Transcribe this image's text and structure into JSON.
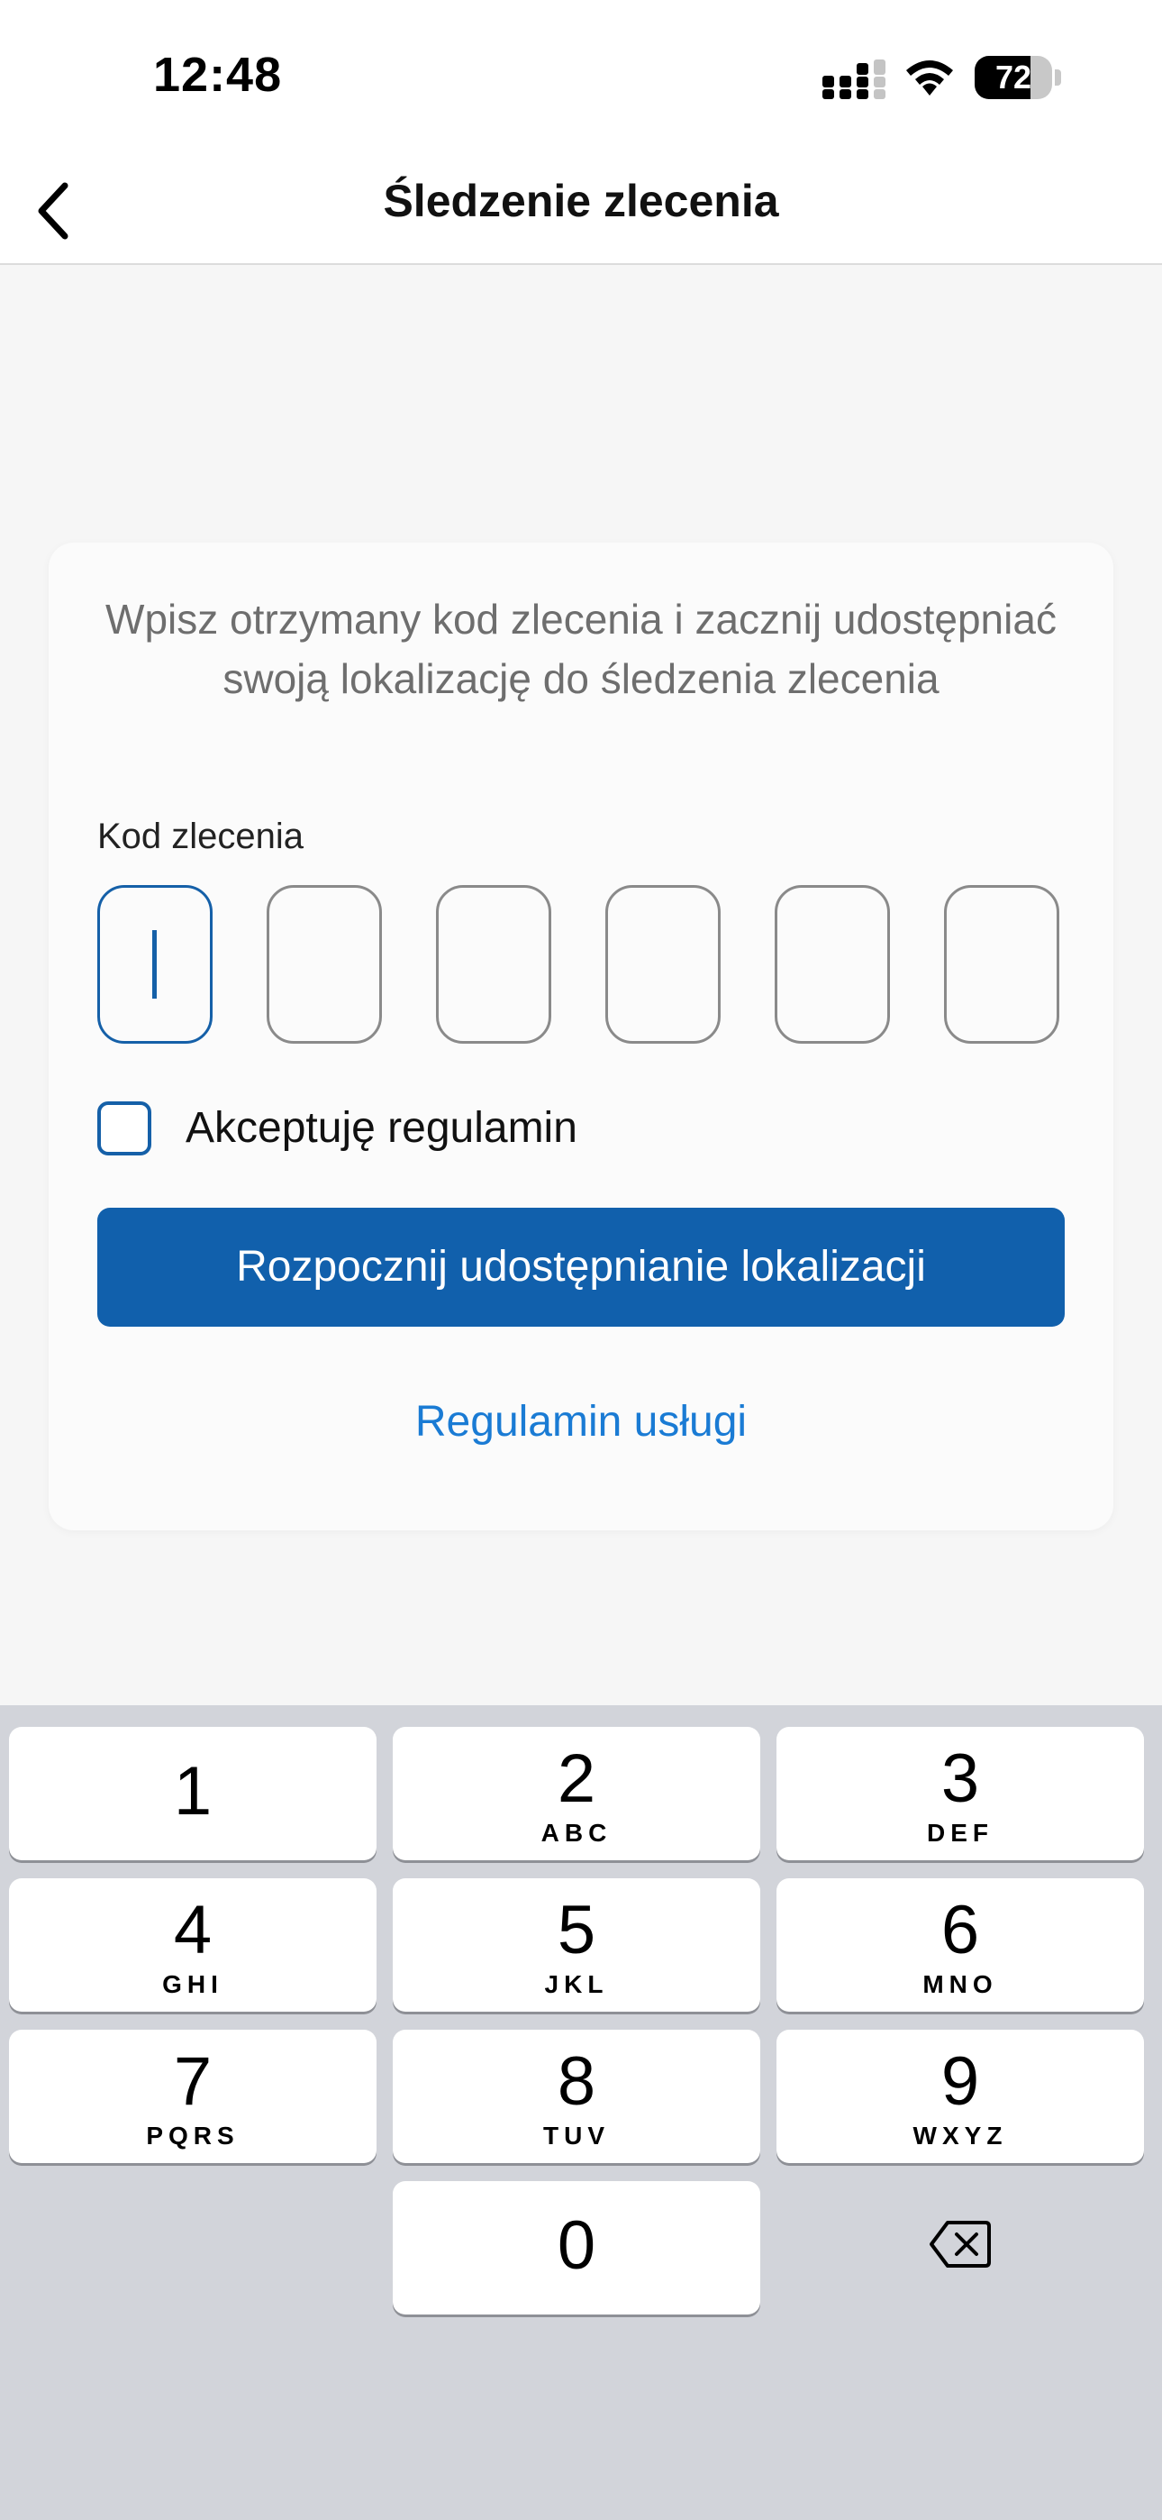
{
  "status_bar": {
    "time": "12:48",
    "battery_level": "72",
    "icons": [
      "signal-icon",
      "wifi-icon",
      "battery-icon"
    ]
  },
  "nav": {
    "title": "Śledzenie zlecenia",
    "back_icon": "chevron-left-icon"
  },
  "card": {
    "instruction": "Wpisz otrzymany kod zlecenia i zacznij udostępniać swoją lokalizację do śledzenia zlecenia",
    "code_label": "Kod zlecenia",
    "code_cells": [
      "",
      "",
      "",
      "",
      "",
      ""
    ],
    "active_cell": 1,
    "checkbox_label": "Akceptuję regulamin",
    "checkbox_checked": false,
    "primary_button": "Rozpocznij udostępnianie lokalizacji",
    "terms_link": "Regulamin usługi"
  },
  "keyboard": {
    "keys": [
      {
        "digit": "1",
        "letters": ""
      },
      {
        "digit": "2",
        "letters": "ABC"
      },
      {
        "digit": "3",
        "letters": "DEF"
      },
      {
        "digit": "4",
        "letters": "GHI"
      },
      {
        "digit": "5",
        "letters": "JKL"
      },
      {
        "digit": "6",
        "letters": "MNO"
      },
      {
        "digit": "7",
        "letters": "PQRS"
      },
      {
        "digit": "8",
        "letters": "TUV"
      },
      {
        "digit": "9",
        "letters": "WXYZ"
      },
      {
        "digit": "0",
        "letters": ""
      }
    ],
    "delete_icon": "backspace-icon"
  },
  "colors": {
    "primary": "#1160ac",
    "link": "#1a7bd4",
    "active_border": "#1560a8",
    "background": "#f6f6f6",
    "keyboard_bg": "#d2d4da"
  }
}
